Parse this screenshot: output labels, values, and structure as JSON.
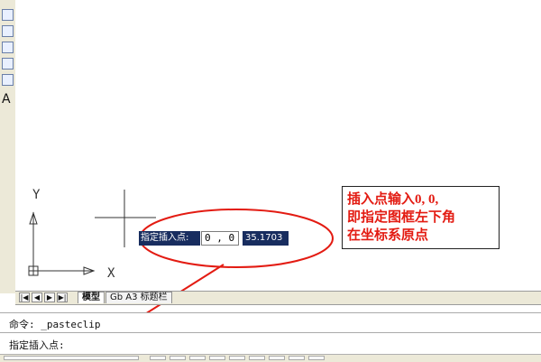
{
  "drawing": {
    "ucs": {
      "x_label": "X",
      "y_label": "Y"
    },
    "tooltip": {
      "prompt_label": "指定插入点:",
      "input_value": "0 , 0",
      "readout_value": "35.1703"
    },
    "callout": {
      "line1": "插入点输入0, 0,",
      "line2": "即指定图框左下角",
      "line3": "在坐标系原点"
    }
  },
  "layout_tabs": {
    "navigation_buttons": [
      "|◀",
      "◀",
      "▶",
      "▶|"
    ],
    "tabs": [
      {
        "label": "模型",
        "active": true
      },
      {
        "label": "Gb A3 标题栏",
        "active": false
      }
    ]
  },
  "command_line": {
    "history": "命令: _pasteclip",
    "prompt": "指定插入点:"
  },
  "left_toolbar": {
    "icons": [
      "ellipse-icon",
      "hatch-icon",
      "region-icon",
      "table-icon",
      "multiline-text-icon"
    ],
    "text_tool_label": "A"
  },
  "colors": {
    "annotation_red": "#e31b12",
    "tooltip_blue": "#182d5f",
    "background": "#ffffff"
  }
}
